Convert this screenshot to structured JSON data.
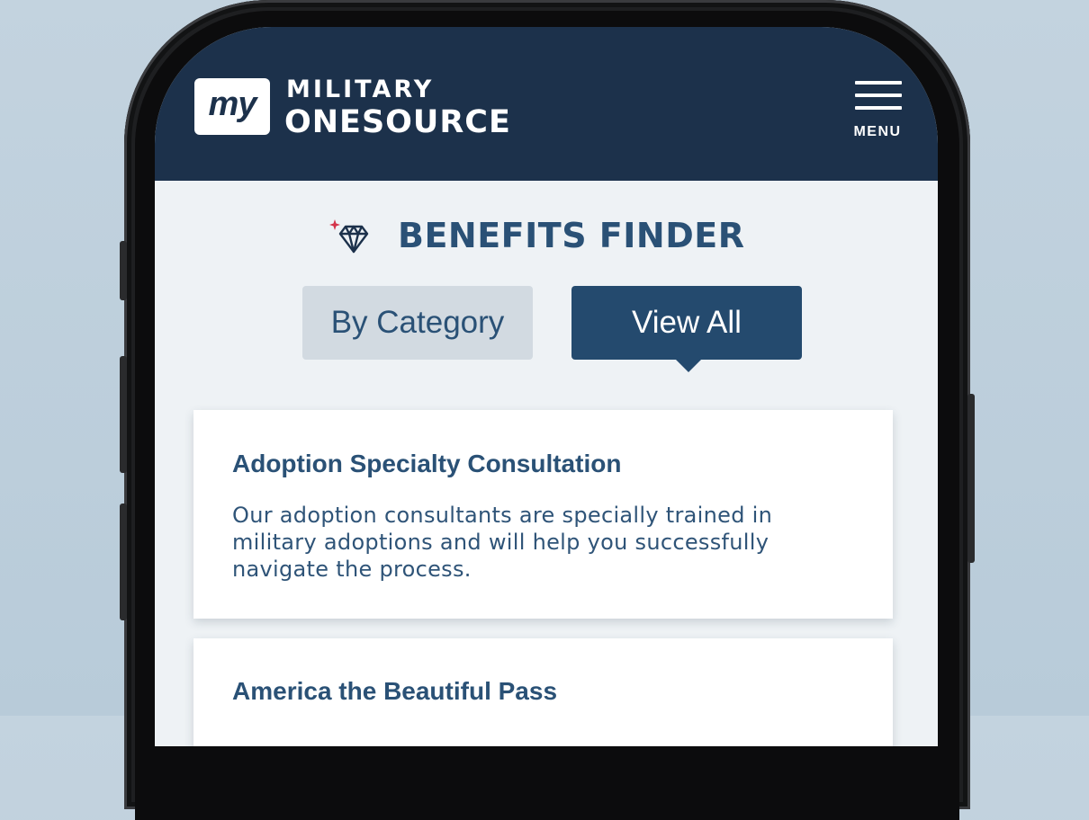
{
  "app": {
    "logo_my": "my",
    "logo_top": "MILITARY",
    "logo_bottom": "ONESOURCE",
    "menu_label": "MENU"
  },
  "finder": {
    "title": "BENEFITS FINDER",
    "icon": "diamond-icon"
  },
  "tabs": [
    {
      "label": "By Category",
      "selected": false
    },
    {
      "label": "View All",
      "selected": true
    }
  ],
  "cards": [
    {
      "title": "Adoption Specialty Consultation",
      "description": "Our adoption consultants are specially trained in military adoptions and will help you successfully navigate the process."
    },
    {
      "title": "America the Beautiful Pass",
      "description": ""
    }
  ],
  "colors": {
    "background": "#c3d3df",
    "header": "#1c314b",
    "accent": "#2a5176",
    "tab_selected": "#244a6e",
    "tab_unselected": "#d2dae1",
    "sparkle": "#d4344a"
  }
}
